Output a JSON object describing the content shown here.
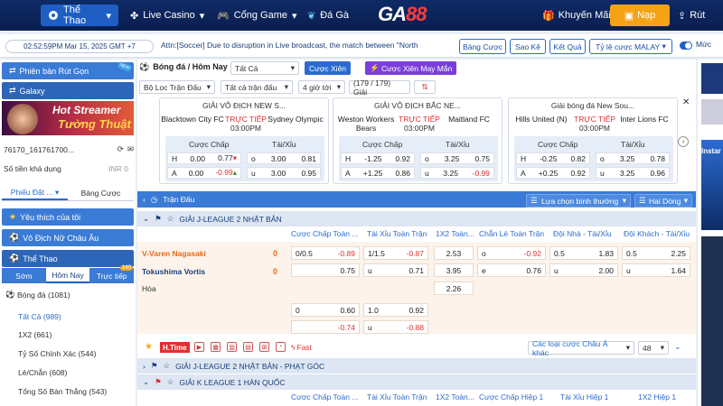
{
  "nav": {
    "tabs": [
      {
        "label": "Thể Thao"
      },
      {
        "label": "Live Casino"
      },
      {
        "label": "Cổng Game"
      },
      {
        "label": "Đá Gà"
      }
    ],
    "logo_a": "GA",
    "logo_b": "88",
    "promo": "Khuyến Mãi",
    "deposit": "Nạp",
    "withdraw": "Rút"
  },
  "bar": {
    "clock": "02:52:59PM Mar 15, 2025 GMT +7",
    "marquee": "Attn:[Soccer] Due to disruption in Live broadcast, the match between \"North",
    "buttons": [
      "Bảng Cược",
      "Sao Kê",
      "Kết Quả",
      "Tỷ lệ cược MALAY"
    ],
    "right_label": "Mức"
  },
  "left": {
    "header1": "Phiên bản Rút Gọn",
    "header1_badge": "NEW",
    "header2": "Galaxy",
    "banner_t1": "Hot Streamer",
    "banner_t2": "Tường Thuật",
    "user": "76170_161761700...",
    "balance_label": "Số tiền khả dụng",
    "balance_value": "INR 0",
    "tab_a": "Phiếu Đặt ...",
    "tab_b": "Bảng Cược",
    "fav": "Yêu thích của tôi",
    "euro": "Vô Địch Nữ Châu Âu",
    "sports": "Thể Thao",
    "stabs": [
      "Sớm",
      "Hôm Nay",
      "Trực tiếp"
    ],
    "live_count": "140",
    "football": "Bóng đá",
    "football_count": "(1081)",
    "subs": [
      {
        "label": "Tất Cả",
        "count": "(989)"
      },
      {
        "label": "1X2",
        "count": "(661)"
      },
      {
        "label": "Tỷ Số Chính Xác",
        "count": "(544)"
      },
      {
        "label": "Lẻ/Chẵn",
        "count": "(608)"
      },
      {
        "label": "Tổng Số Bàn Thắng",
        "count": "(543)"
      }
    ]
  },
  "main": {
    "title": "Bóng đá / Hôm Nay",
    "all": "Tất Cả",
    "parlay": "Cược Xiên",
    "lucky": "Cược Xiên May Mắn",
    "filter_league": "Bộ Lọc Trận Đấu",
    "all_matches": "Tất cả trận đấu",
    "hours": "4 giờ tới",
    "count": "(179 / 179) Giải"
  },
  "cards": [
    {
      "league": "GIẢI VÔ ĐỊCH NEW S...",
      "home": "Blacktown City FC",
      "away": "Sydney Olympic",
      "live": "TRỰC TIẾP",
      "time": "03:00PM",
      "hdp": "Cược Chấp",
      "ou": "Tài/Xỉu",
      "r1": [
        "H",
        "0.00",
        "0.77",
        "o",
        "3.00",
        "0.81"
      ],
      "r2": [
        "A",
        "0.00",
        "-0.99",
        "u",
        "3.00",
        "0.95"
      ]
    },
    {
      "league": "GIẢI VÔ ĐỊCH BẮC NE...",
      "home": "Weston Workers Bears",
      "away": "Maitland FC",
      "live": "TRỰC TIẾP",
      "time": "03:00PM",
      "hdp": "Cược Chấp",
      "ou": "Tài/Xỉu",
      "r1": [
        "H",
        "-1.25",
        "0.92",
        "o",
        "3.25",
        "0.75"
      ],
      "r2": [
        "A",
        "+1.25",
        "0.86",
        "u",
        "3.25",
        "-0.99"
      ]
    },
    {
      "league": "Giải bóng đá New Sou...",
      "home": "Hills United (N)",
      "away": "Inter Lions FC",
      "live": "TRỰC TIẾP",
      "time": "03:00PM",
      "hdp": "Cược Chấp",
      "ou": "Tài/Xỉu",
      "r1": [
        "H",
        "-0.25",
        "0.82",
        "o",
        "3.25",
        "0.78"
      ],
      "r2": [
        "A",
        "+0.25",
        "0.92",
        "u",
        "3.25",
        "0.96"
      ]
    }
  ],
  "table": {
    "section": "Trận Đấu",
    "sort": "Lựa chọn bình thường",
    "lines": "Hai Dòng",
    "league1": "GIẢI J-LEAGUE 2 NHẬT BẢN",
    "cols": [
      "Cược Chấp Toàn ...",
      "Tài Xỉu Toàn Trận",
      "1X2 Toàn...",
      "Chẵn Lẻ Toàn Trận",
      "Đội Nhà - Tài/Xỉu",
      "Đội Khách - Tài/Xỉu"
    ],
    "home": "V-Varen Nagasaki",
    "away": "Tokushima Vortis",
    "draw": "Hòa",
    "home_score": "0",
    "away_score": "0",
    "row1": {
      "hdp_line": "0/0.5",
      "hdp_odd": "-0.89",
      "ou_line": "1/1.5",
      "ou_odd": "-0.87",
      "x12": "2.53",
      "oe_tag": "o",
      "oe_odd": "-0.92",
      "hou_line": "0.5",
      "hou_odd": "1.83",
      "aou_line": "0.5",
      "aou_odd": "2.25"
    },
    "row2": {
      "hdp_odd": "0.75",
      "ou_tag": "u",
      "ou_odd": "0.71",
      "x12": "3.95",
      "oe_tag": "e",
      "oe_odd": "0.76",
      "hou_tag": "u",
      "hou_odd": "2.00",
      "aou_tag": "u",
      "aou_odd": "1.64"
    },
    "row3": {
      "x12": "2.26"
    },
    "row4": {
      "hdp_line": "0",
      "hdp_odd": "0.60",
      "ou_line": "1.0",
      "ou_odd": "0.92"
    },
    "row5": {
      "hdp_odd": "-0.74",
      "ou_tag": "u",
      "ou_odd": "-0.88"
    },
    "htime": "H.Time",
    "fast": "Fast",
    "asian": "Các loại cược Châu Á khác",
    "page": "48",
    "league2": "GIẢI J-LEAGUE 2 NHẬT BẢN - PHẠT GÓC",
    "league3": "GIẢI K LEAGUE 1 HÀN QUỐC",
    "cols2": [
      "Cược Chấp Toàn ...",
      "Tài Xỉu Toàn Trận",
      "1X2 Toàn...",
      "Cược Chấp Hiệp 1",
      "Tài Xỉu Hiệp 1",
      "1X2 Hiệp 1"
    ]
  },
  "right": {
    "label": "Instar"
  },
  "colors": {
    "nav": "#0e2a66",
    "accent": "#2b6bd1",
    "deposit": "#f4a316",
    "live": "#e23030"
  }
}
